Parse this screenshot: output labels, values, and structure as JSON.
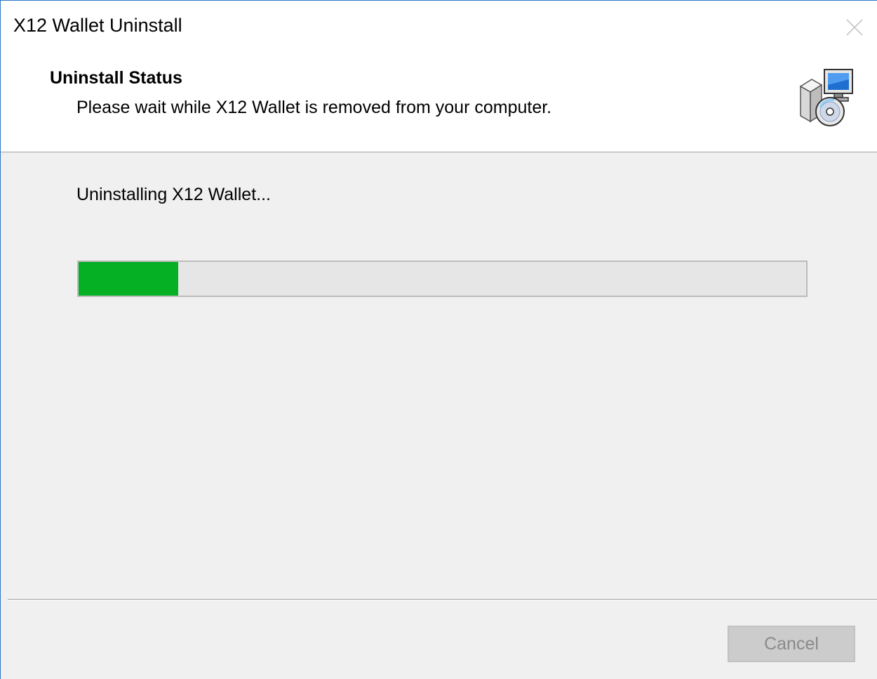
{
  "window": {
    "title": "X12 Wallet Uninstall",
    "close_icon": "close-icon"
  },
  "header": {
    "title": "Uninstall Status",
    "subtitle": "Please wait while X12 Wallet is removed from your computer.",
    "icon": "installer-package-icon"
  },
  "main": {
    "status_text": "Uninstalling X12 Wallet...",
    "progress_fraction": 0.137,
    "progress_color": "#06b025"
  },
  "footer": {
    "cancel_label": "Cancel",
    "cancel_disabled": true
  }
}
